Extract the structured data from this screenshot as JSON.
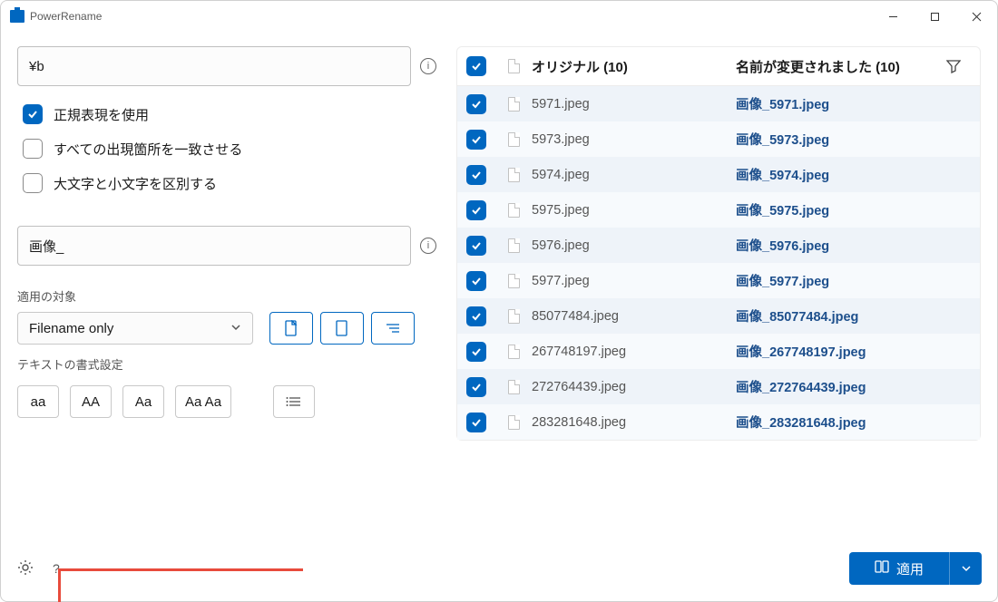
{
  "window": {
    "title": "PowerRename"
  },
  "search": {
    "value": "¥b"
  },
  "options": {
    "regex": {
      "label": "正規表現を使用",
      "checked": true
    },
    "match_all": {
      "label": "すべての出現箇所を一致させる",
      "checked": false
    },
    "case_sensitive": {
      "label": "大文字と小文字を区別する",
      "checked": false
    }
  },
  "replace": {
    "value": "画像_"
  },
  "apply_to": {
    "label": "適用の対象",
    "selected": "Filename only"
  },
  "text_format": {
    "label": "テキストの書式設定",
    "btn_lower": "aa",
    "btn_upper": "AA",
    "btn_title": "Aa",
    "btn_capitalize": "Aa Aa"
  },
  "header": {
    "original": "オリジナル (10)",
    "renamed": "名前が変更されました (10)"
  },
  "files": [
    {
      "original": "5971.jpeg",
      "renamed": "画像_5971.jpeg",
      "checked": true
    },
    {
      "original": "5973.jpeg",
      "renamed": "画像_5973.jpeg",
      "checked": true
    },
    {
      "original": "5974.jpeg",
      "renamed": "画像_5974.jpeg",
      "checked": true
    },
    {
      "original": "5975.jpeg",
      "renamed": "画像_5975.jpeg",
      "checked": true
    },
    {
      "original": "5976.jpeg",
      "renamed": "画像_5976.jpeg",
      "checked": true
    },
    {
      "original": "5977.jpeg",
      "renamed": "画像_5977.jpeg",
      "checked": true
    },
    {
      "original": "85077484.jpeg",
      "renamed": "画像_85077484.jpeg",
      "checked": true
    },
    {
      "original": "267748197.jpeg",
      "renamed": "画像_267748197.jpeg",
      "checked": true
    },
    {
      "original": "272764439.jpeg",
      "renamed": "画像_272764439.jpeg",
      "checked": true
    },
    {
      "original": "283281648.jpeg",
      "renamed": "画像_283281648.jpeg",
      "checked": true
    }
  ],
  "apply_button": "適用"
}
